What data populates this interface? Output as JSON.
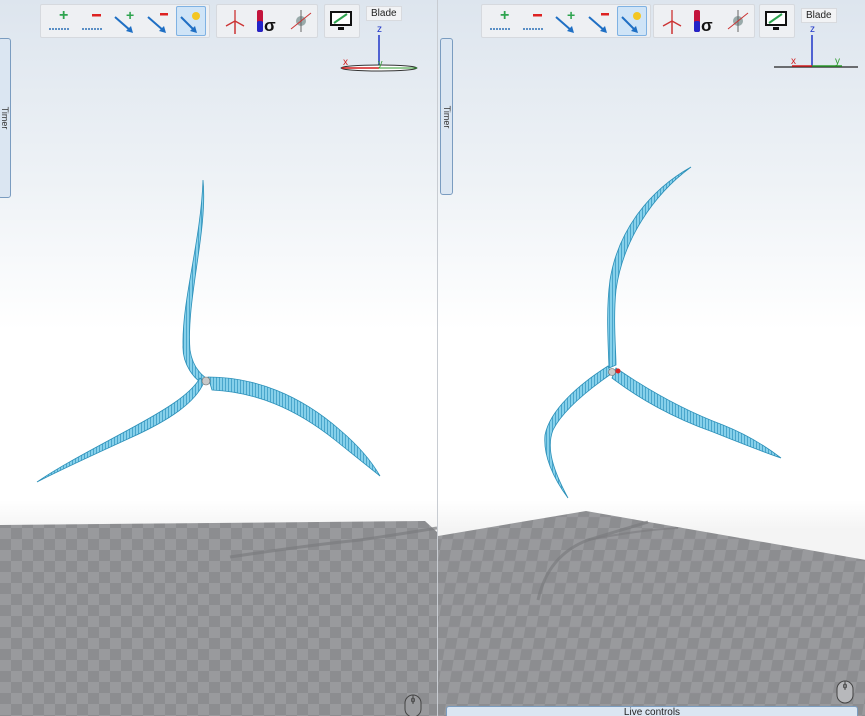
{
  "views": [
    {
      "id": "left",
      "toolbar_buttons": [
        {
          "name": "add-node-icon",
          "active": false
        },
        {
          "name": "remove-node-icon",
          "active": false
        },
        {
          "name": "add-light-icon",
          "active": false
        },
        {
          "name": "remove-light-icon",
          "active": false
        },
        {
          "name": "light-icon",
          "active": true
        },
        {
          "name": "turbine-icon",
          "active": false
        },
        {
          "name": "stress-sigma-icon",
          "active": false
        },
        {
          "name": "probe-icon",
          "active": false
        },
        {
          "name": "monitor-icon",
          "active": false
        }
      ],
      "blade_label": "Blade",
      "timer_tab": "Timer",
      "axes": {
        "z": "z",
        "x": "x",
        "y": "y"
      }
    },
    {
      "id": "right",
      "toolbar_buttons": [
        {
          "name": "add-node-icon",
          "active": false
        },
        {
          "name": "remove-node-icon",
          "active": false
        },
        {
          "name": "add-light-icon",
          "active": false
        },
        {
          "name": "remove-light-icon",
          "active": false
        },
        {
          "name": "light-icon",
          "active": true
        },
        {
          "name": "turbine-icon",
          "active": false
        },
        {
          "name": "stress-sigma-icon",
          "active": false
        },
        {
          "name": "probe-icon",
          "active": false
        },
        {
          "name": "monitor-icon",
          "active": false
        }
      ],
      "blade_label": "Blade",
      "timer_tab": "Timer",
      "axes": {
        "z": "z",
        "x": "x",
        "y": "y"
      },
      "live_controls": "Live controls"
    }
  ],
  "colors": {
    "blade_fill": "#7fcbe6",
    "blade_edge": "#2a8fb8",
    "floor": "#8e8f92",
    "active_button": "#cfe4f7",
    "axis_x": "#d21f1f",
    "axis_y": "#2e9a2e",
    "axis_z": "#1f35c8"
  }
}
